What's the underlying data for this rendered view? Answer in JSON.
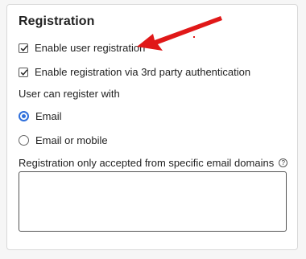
{
  "panel": {
    "title": "Registration"
  },
  "options": {
    "enable_user_registration": {
      "label": "Enable user registration",
      "checked": true
    },
    "enable_third_party": {
      "label": "Enable registration via 3rd party authentication",
      "checked": true
    }
  },
  "register_with": {
    "label": "User can register with",
    "choices": [
      {
        "label": "Email",
        "selected": true
      },
      {
        "label": "Email or mobile",
        "selected": false
      }
    ]
  },
  "domains": {
    "label": "Registration only accepted from specific email domains",
    "help_icon": "question-circle-icon",
    "value": ""
  },
  "annotation": {
    "color": "#e01818"
  },
  "colors": {
    "accent": "#2f6fdb"
  }
}
